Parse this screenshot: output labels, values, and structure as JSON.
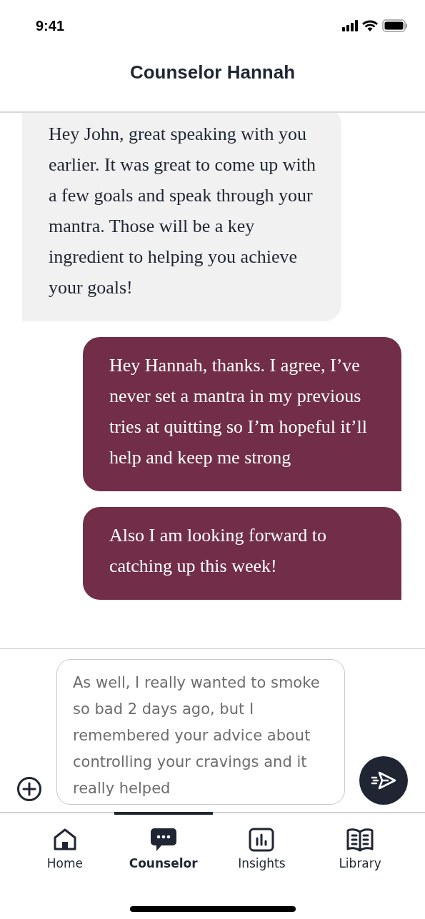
{
  "status_bar": {
    "time": "9:41"
  },
  "header": {
    "title": "Counselor Hannah"
  },
  "messages": [
    {
      "kind": "received",
      "text": "Hey John, great speaking with you earlier. It was great to come up with a few goals and speak through your mantra. Those will be a key ingredient to helping you achieve your goals!"
    },
    {
      "kind": "sent",
      "text": "Hey Hannah, thanks. I agree, I’ve never set a mantra in my previous tries at quitting so I’m hopeful it’ll help and keep me strong"
    },
    {
      "kind": "sent",
      "text": "Also I am looking forward to catching up this week!"
    }
  ],
  "composer": {
    "value": "As well, I really wanted to smoke so bad 2 days ago, but I remembered your advice about controlling your cravings and it really helped"
  },
  "tabs": [
    {
      "label": "Home",
      "selected": false
    },
    {
      "label": "Counselor",
      "selected": true
    },
    {
      "label": "Insights",
      "selected": false
    },
    {
      "label": "Library",
      "selected": false
    }
  ]
}
